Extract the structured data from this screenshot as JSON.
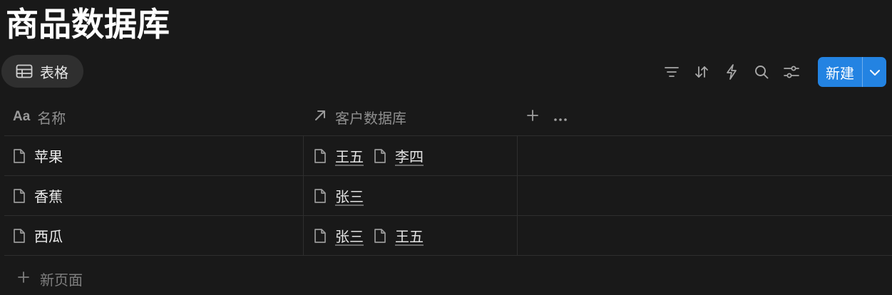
{
  "page": {
    "title": "商品数据库"
  },
  "view": {
    "tab_label": "表格",
    "tab_icon": "table-icon"
  },
  "toolbar": {
    "icons": [
      "filter-icon",
      "sort-icon",
      "automation-icon",
      "search-icon",
      "settings-icon"
    ],
    "new_label": "新建",
    "dropdown_icon": "chevron-down-icon"
  },
  "table": {
    "columns": [
      {
        "label": "名称",
        "icon": "Aa"
      },
      {
        "label": "客户数据库",
        "icon": "relation-arrow-icon"
      }
    ],
    "rows": [
      {
        "name": "苹果",
        "relations": [
          "王五",
          "李四"
        ]
      },
      {
        "name": "香蕉",
        "relations": [
          "张三"
        ]
      },
      {
        "name": "西瓜",
        "relations": [
          "张三",
          "王五"
        ]
      }
    ]
  },
  "footer": {
    "new_page_label": "新页面"
  },
  "colors": {
    "background": "#191919",
    "accent": "#2383e2",
    "tab_bg": "#2f2f2f",
    "border": "#2e2e2e"
  }
}
